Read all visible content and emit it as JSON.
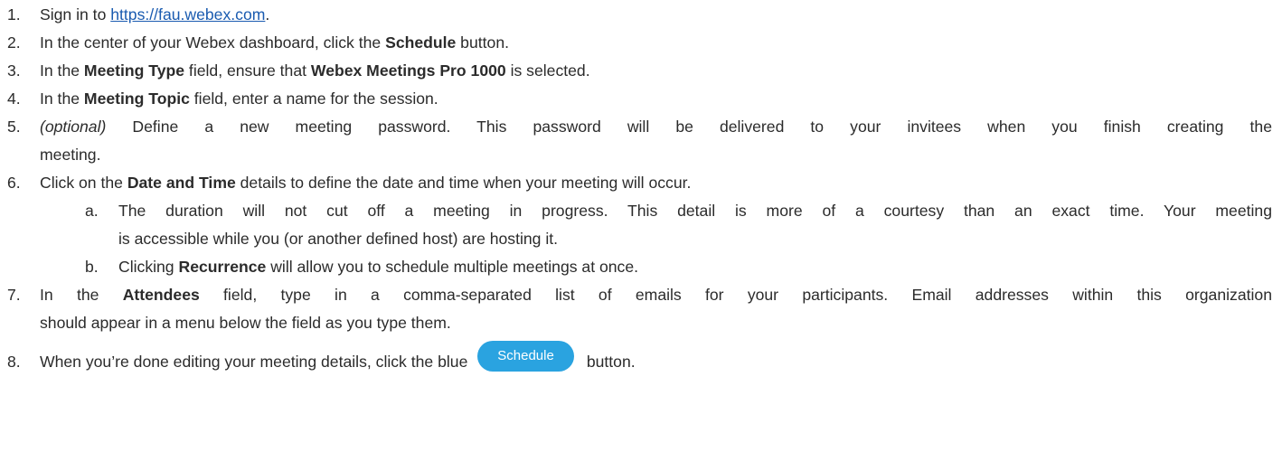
{
  "steps": {
    "s1": {
      "num": "1.",
      "pre": "Sign in to ",
      "link": "https://fau.webex.com",
      "post": "."
    },
    "s2": {
      "num": "2.",
      "pre": "In the center of your Webex dashboard, click the ",
      "bold": "Schedule",
      "post": " button."
    },
    "s3": {
      "num": "3.",
      "pre": "In the ",
      "bold1": "Meeting Type",
      "mid": " field, ensure that ",
      "bold2": "Webex Meetings Pro 1000",
      "post": " is selected."
    },
    "s4": {
      "num": "4.",
      "pre": "In the ",
      "bold": "Meeting Topic",
      "post": " field, enter a name for the session."
    },
    "s5": {
      "num": "5.",
      "italic": "(optional)",
      "line1": " Define a new meeting password. This password will be delivered to your invitees when you finish creating the",
      "line2": "meeting."
    },
    "s6": {
      "num": "6.",
      "pre": "Click on the ",
      "bold": "Date and Time",
      "post": " details to define the date and time when your meeting will occur."
    },
    "s6a": {
      "num": "a.",
      "line1": "The duration will not cut off a meeting in progress. This detail is more of a courtesy than an exact time. Your meeting",
      "line2": "is accessible while you (or another defined host) are hosting it."
    },
    "s6b": {
      "num": "b.",
      "pre": "Clicking ",
      "bold": "Recurrence",
      "post": " will allow you to schedule multiple meetings at once."
    },
    "s7": {
      "num": "7.",
      "pre": "In the ",
      "bold": "Attendees",
      "line1": " field, type in a comma-separated list of emails for your participants. Email addresses within this organization",
      "line2": "should appear in a menu below the field as you type them."
    },
    "s8": {
      "num": "8.",
      "pre": "When you’re done editing your meeting details, click the blue ",
      "button": "Schedule",
      "post": "button."
    }
  },
  "colors": {
    "text": "#2b2b2b",
    "link": "#1a5bb0",
    "button_bg": "#2aa3e0",
    "button_text": "#ffffff"
  }
}
